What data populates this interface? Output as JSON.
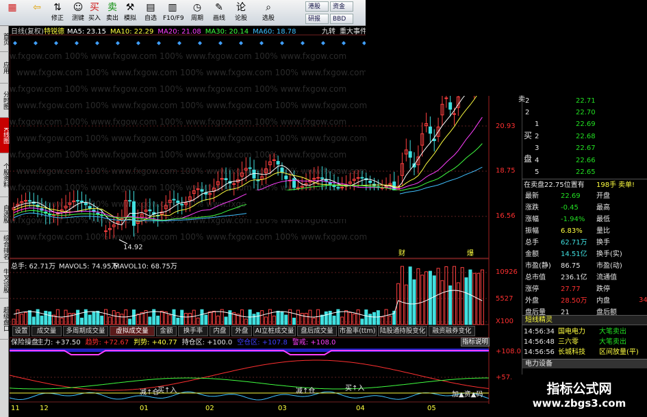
{
  "toolbar": {
    "buttons": [
      {
        "label": "",
        "icon": "logo-icon"
      },
      {
        "label": "",
        "icon": "back-arrow-icon"
      },
      {
        "label": "修正",
        "icon": "arrow-updown-icon"
      },
      {
        "label": "测键",
        "icon": "smiley-icon"
      },
      {
        "label": "买入",
        "icon": "buy-icon"
      },
      {
        "label": "卖出",
        "icon": "sell-icon"
      },
      {
        "label": "模拟",
        "icon": "hammer-icon"
      },
      {
        "label": "自选",
        "icon": "grid-icon"
      },
      {
        "label": "F10/F9",
        "icon": "f10-icon"
      },
      {
        "label": "周期",
        "icon": "clock-icon"
      },
      {
        "label": "画线",
        "icon": "pencil-icon"
      },
      {
        "label": "论股",
        "icon": "discuss-icon"
      },
      {
        "label": "选股",
        "icon": "search-icon"
      }
    ],
    "small_buttons": [
      "港股",
      "资金",
      "研报",
      "BBD"
    ]
  },
  "sidebar": {
    "tabs": [
      "首页",
      "应用",
      "分时图",
      "K线图",
      "个股资料",
      "自选股",
      "综合排名",
      "牛叉诊股",
      "超级盘口"
    ]
  },
  "kline": {
    "period_label": "日线(复权)",
    "indicator_name": "特锐德",
    "ma": [
      {
        "label": "MA5: 23.15",
        "color": "#ffffff"
      },
      {
        "label": "MA10: 22.29",
        "color": "#ffff40"
      },
      {
        "label": "MA20: 21.08",
        "color": "#ff40ff"
      },
      {
        "label": "MA30: 20.14",
        "color": "#40ff40"
      },
      {
        "label": "MA60: 18.78",
        "color": "#40c0ff"
      }
    ],
    "top_right": [
      "九转",
      "重大事件"
    ],
    "low_label": "14.92",
    "markers": [
      "财",
      "爆"
    ]
  },
  "volume": {
    "label": "总手: 62.71万",
    "mavol5": "MAVOL5: 74.95万",
    "mavol10": "MAVOL10: 68.75万",
    "tabs": [
      "设置",
      "成交量",
      "多周期成交量",
      "虚拟成交量",
      "金额",
      "换手率",
      "内盘",
      "外盘",
      "AI立桩成交量",
      "盘后成交量",
      "市盈率(ttm)",
      "陆股通持股变化",
      "融资融券变化"
    ],
    "active_tab": "虚拟成交量"
  },
  "osc": {
    "title": "保险操盘",
    "items": [
      {
        "label": "主力: +37.50",
        "color": "#e8e8e8"
      },
      {
        "label": "趋势: +72.67",
        "color": "#ff3030"
      },
      {
        "label": "判势: +40.77",
        "color": "#ffff40"
      },
      {
        "label": "持仓区: +100.0",
        "color": "#e8e8e8"
      },
      {
        "label": "空仓区: +107.8",
        "color": "#4040ff"
      },
      {
        "label": "警戒: +108.0",
        "color": "#ff40ff"
      }
    ],
    "help_button": "指标说明",
    "annotations": [
      "减↑仓",
      "买↑入",
      "减↑仓",
      "买↑入",
      "加▲资▲码"
    ],
    "axis_right": [
      "+108.0",
      "+57.1"
    ]
  },
  "chart_data": [
    {
      "type": "candlestick",
      "title": "日线(复权)",
      "y_ticks": [
        "20.93",
        "18.75",
        "16.56"
      ],
      "x_ticks": [
        "11",
        "12",
        "01",
        "02",
        "03",
        "04",
        "05"
      ]
    },
    {
      "type": "bar",
      "title": "虚拟成交量",
      "y_ticks": [
        "10926",
        "5527",
        "X100"
      ]
    },
    {
      "type": "line",
      "title": "保险操盘",
      "y_ticks": [
        "+108.0",
        "+57.1"
      ]
    }
  ],
  "quote": {
    "sell": [
      {
        "lvl": "2",
        "price": "22.71"
      },
      {
        "lvl": "2",
        "price": "22.70"
      }
    ],
    "buy_label_1": "买",
    "buy_label_2": "盘",
    "sell_label": "卖",
    "buy": [
      {
        "lvl": "1",
        "price": "22.69"
      },
      {
        "lvl": "2",
        "price": "22.68"
      },
      {
        "lvl": "3",
        "price": "22.67"
      },
      {
        "lvl": "4",
        "price": "22.66"
      },
      {
        "lvl": "5",
        "price": "22.65"
      }
    ],
    "position_text": "在卖盘22.75位置有",
    "position_qty": "198手",
    "position_tag": "卖单!",
    "stats": [
      {
        "k": "最新",
        "v": "22.69",
        "vc": "green",
        "k2": "开盘"
      },
      {
        "k": "涨跌",
        "v": "-0.45",
        "vc": "green",
        "k2": "最高"
      },
      {
        "k": "涨幅",
        "v": "-1.94%",
        "vc": "green",
        "k2": "最低"
      },
      {
        "k": "振幅",
        "v": "6.83%",
        "vc": "yellow",
        "k2": "量比"
      },
      {
        "k": "总手",
        "v": "62.71万",
        "vc": "cyan",
        "k2": "换手"
      },
      {
        "k": "金额",
        "v": "14.51亿",
        "vc": "cyan",
        "k2": "换手(实)"
      },
      {
        "k": "市盈(静)",
        "v": "86.75",
        "vc": "white",
        "k2": "市盈(动)"
      },
      {
        "k": "总市值",
        "v": "236.1亿",
        "vc": "white",
        "k2": "流通值"
      },
      {
        "k": "涨停",
        "v": "27.77",
        "vc": "red",
        "k2": "跌停"
      },
      {
        "k": "外盘",
        "v": "28.50万",
        "vc": "red",
        "k2": "内盘"
      },
      {
        "k": "盘后量",
        "v": "21",
        "vc": "white",
        "k2": "盘后额"
      }
    ],
    "right_edge": [
      "34"
    ],
    "elf_title": "短线精灵",
    "elf": [
      {
        "time": "14:56:34",
        "name": "国电电力",
        "event": "大笔卖出",
        "ec": "green"
      },
      {
        "time": "14:56:48",
        "name": "三六零",
        "event": "大笔卖出",
        "ec": "green"
      },
      {
        "time": "14:56:56",
        "name": "长城科技",
        "event": "区间放量(平)",
        "ec": "yellow"
      }
    ],
    "sector_label": "电力设备"
  },
  "watermark": {
    "line1": "指标公式网",
    "line2": "www.zbgs3.com"
  }
}
